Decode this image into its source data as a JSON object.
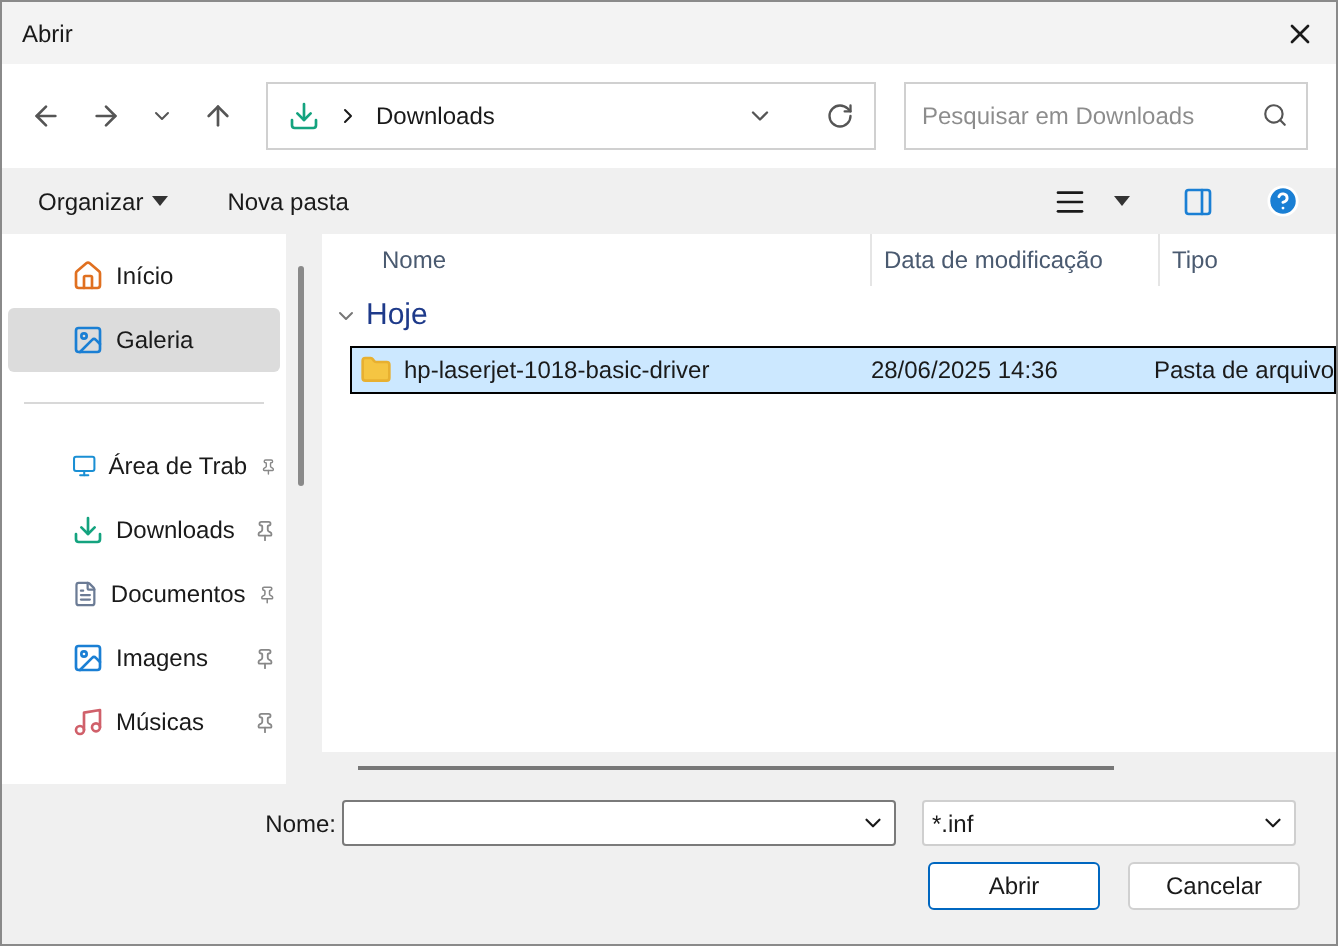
{
  "window": {
    "title": "Abrir"
  },
  "address": {
    "path": "Downloads"
  },
  "search": {
    "placeholder": "Pesquisar em Downloads"
  },
  "toolbar": {
    "organize": "Organizar",
    "new_folder": "Nova pasta"
  },
  "sidebar": {
    "items": [
      {
        "label": "Início",
        "kind": "home",
        "selected": false,
        "pinned": false
      },
      {
        "label": "Galeria",
        "kind": "gallery",
        "selected": true,
        "pinned": false
      },
      {
        "kind": "divider"
      },
      {
        "label": "Área de Trab",
        "kind": "desktop",
        "selected": false,
        "pinned": true
      },
      {
        "label": "Downloads",
        "kind": "download",
        "selected": false,
        "pinned": true
      },
      {
        "label": "Documentos",
        "kind": "document",
        "selected": false,
        "pinned": true
      },
      {
        "label": "Imagens",
        "kind": "image",
        "selected": false,
        "pinned": true
      },
      {
        "label": "Músicas",
        "kind": "music",
        "selected": false,
        "pinned": true
      }
    ]
  },
  "table": {
    "columns": [
      "Nome",
      "Data de modificação",
      "Tipo"
    ],
    "groups": [
      {
        "label": "Hoje",
        "expanded": true,
        "rows": [
          {
            "name": "hp-laserjet-1018-basic-driver",
            "date": "28/06/2025 14:36",
            "type": "Pasta de arquivo",
            "selected": true
          }
        ]
      }
    ]
  },
  "footer": {
    "name_label": "Nome:",
    "filter": "*.inf",
    "buttons": [
      "Abrir",
      "Cancelar"
    ]
  }
}
